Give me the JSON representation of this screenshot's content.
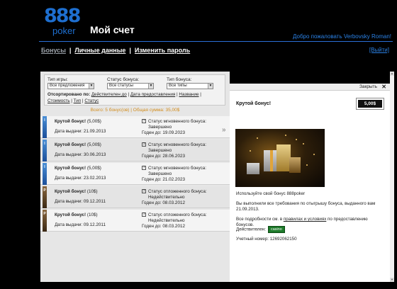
{
  "header": {
    "logo_number": "888",
    "logo_word": "poker",
    "page_title": "Мой счет",
    "welcome": "Добро пожаловать Verbovsky Roman!",
    "logout": "[Выйти]"
  },
  "nav": {
    "items": [
      {
        "label": "Бонусы"
      },
      {
        "label": "Личные данные"
      },
      {
        "label": "Изменить пароль"
      }
    ],
    "separator": "|"
  },
  "filters": {
    "game_type_label": "Тип игры:",
    "game_type_value": "Все предложения",
    "status_label": "Статус бонуса:",
    "status_value": "Все статусы",
    "bonus_type_label": "Тип бонуса:",
    "bonus_type_value": "Все типы"
  },
  "sort": {
    "label": "Отсортировано по:",
    "options": [
      "Действителен до",
      "Дата предоставления",
      "Название",
      "Стоимость",
      "Тип",
      "Статус"
    ],
    "separator": "|"
  },
  "totals": {
    "count": "Всего: 5 бонус(ов)",
    "sum": "Общая сумма: 35,00$"
  },
  "bonuses": [
    {
      "type_letter": "I",
      "name": "Крутой бонус!",
      "amount": "(5,00$)",
      "issued": "Дата выдачи: 21.09.2013",
      "status": "Статус мгновенного бонуса: Завершено",
      "valid": "Годен до: 19.09.2023"
    },
    {
      "type_letter": "I",
      "name": "Крутой бонус!",
      "amount": "(5,00$)",
      "issued": "Дата выдачи: 30.06.2013",
      "status": "Статус мгновенного бонуса: Завершено",
      "valid": "Годен до: 28.06.2023"
    },
    {
      "type_letter": "I",
      "name": "Крутой бонус!",
      "amount": "(5,00$)",
      "issued": "Дата выдачи: 23.02.2013",
      "status": "Статус мгновенного бонуса: Завершено",
      "valid": "Годен до: 21.02.2023"
    },
    {
      "type_letter": "P",
      "name": "Крутой бонус!",
      "amount": "(10$)",
      "issued": "Дата выдачи: 09.12.2011",
      "status": "Статус отложенного бонуса: Недействительно",
      "valid": "Годен до: 08.03.2012"
    },
    {
      "type_letter": "P",
      "name": "Крутой бонус!",
      "amount": "(10$)",
      "issued": "Дата выдачи: 09.12.2011",
      "status": "Статус отложенного бонуса: Недействительно",
      "valid": "Годен до: 08.03.2012"
    }
  ],
  "detail": {
    "close_label": "Закрыть",
    "close_icon": "✕",
    "title": "Крутой бонус!",
    "amount": "5,00$",
    "use_text": "Используйте свой бонус 888poker",
    "wager_text": "Вы выполнили все требования по отыгрышу бонуса, выданного вам 21.09.2013.",
    "details_prefix": "Все подробности см. в",
    "details_link": "правилах и условиях",
    "details_suffix": "по предоставлению бонусов.",
    "valid_label": "Действителен:",
    "valid_badge": "casino",
    "account_label": "Учетный номер: 12692062150"
  },
  "icons": {
    "question": "?",
    "arrow": "»"
  },
  "colors": {
    "brand_blue": "#1e6fd0",
    "link_blue": "#2b82e6",
    "totals_orange": "#d28c1c"
  }
}
